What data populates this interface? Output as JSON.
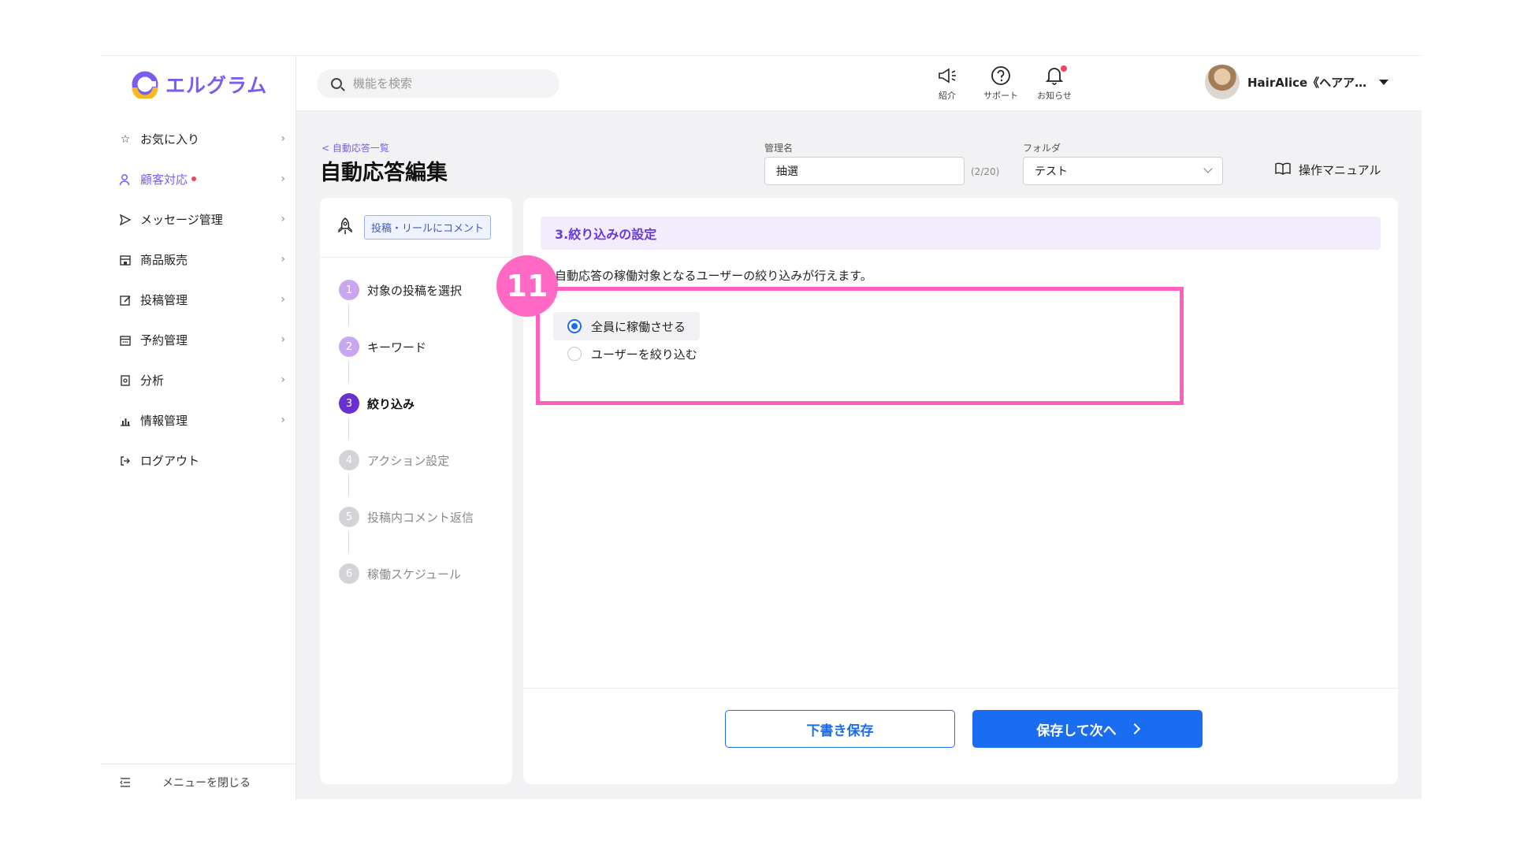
{
  "brand": {
    "name": "エルグラム",
    "accent": "#7a5cf0"
  },
  "sidebar": {
    "items": [
      {
        "label": "お気に入り",
        "icon": "star-icon",
        "active": false
      },
      {
        "label": "顧客対応",
        "icon": "user-icon",
        "active": true,
        "dot": true
      },
      {
        "label": "メッセージ管理",
        "icon": "send-icon",
        "active": false
      },
      {
        "label": "商品販売",
        "icon": "store-icon",
        "active": false
      },
      {
        "label": "投稿管理",
        "icon": "edit-icon",
        "active": false
      },
      {
        "label": "予約管理",
        "icon": "calendar-icon",
        "active": false
      },
      {
        "label": "分析",
        "icon": "report-icon",
        "active": false
      },
      {
        "label": "情報管理",
        "icon": "bar-chart-icon",
        "active": false
      },
      {
        "label": "ログアウト",
        "icon": "logout-icon",
        "active": false
      }
    ],
    "collapse_label": "メニューを閉じる"
  },
  "header": {
    "search_placeholder": "機能を検索",
    "icons": [
      {
        "caption": "紹介",
        "icon": "megaphone-icon"
      },
      {
        "caption": "サポート",
        "icon": "help-icon"
      },
      {
        "caption": "お知らせ",
        "icon": "bell-icon"
      }
    ],
    "user_name": "HairAlice《ヘアア…"
  },
  "page": {
    "breadcrumb": "< 自動応答一覧",
    "title": "自動応答編集",
    "name_label": "管理名",
    "name_value": "抽選",
    "name_counter": "(2/20)",
    "folder_label": "フォルダ",
    "folder_value": "テスト",
    "manual_label": "操作マニュアル"
  },
  "steps": {
    "tag": "投稿・リールにコメント",
    "items": [
      {
        "num": "1",
        "label": "対象の投稿を選択",
        "state": "done"
      },
      {
        "num": "2",
        "label": "キーワード",
        "state": "done"
      },
      {
        "num": "3",
        "label": "絞り込み",
        "state": "current"
      },
      {
        "num": "4",
        "label": "アクション設定",
        "state": "todo"
      },
      {
        "num": "5",
        "label": "投稿内コメント返信",
        "state": "todo"
      },
      {
        "num": "6",
        "label": "稼働スケジュール",
        "state": "todo"
      }
    ]
  },
  "main": {
    "section_title": "3.絞り込みの設定",
    "description": "自動応答の稼働対象となるユーザーの絞り込みが行えます。",
    "options": [
      {
        "label": "全員に稼働させる",
        "selected": true
      },
      {
        "label": "ユーザーを絞り込む",
        "selected": false
      }
    ],
    "annotation_badge": "11",
    "draft_button": "下書き保存",
    "next_button": "保存して次へ"
  },
  "colors": {
    "primary_blue": "#1a6cf0",
    "highlight_pink": "#ff5fbf",
    "step_done": "#c9a6f0",
    "step_current": "#6a2fd0",
    "step_todo": "#d3d3d8"
  }
}
